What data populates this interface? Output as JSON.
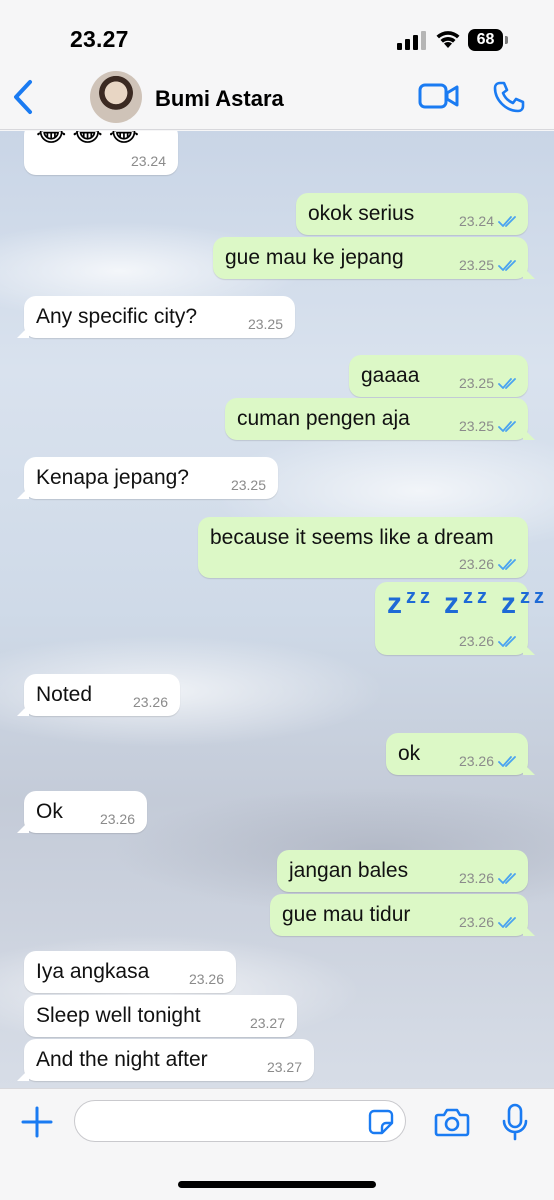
{
  "status_bar": {
    "time": "23.27",
    "battery": "68"
  },
  "header": {
    "contact_name": "Bumi Astara"
  },
  "colors": {
    "accent": "#1a7bf2",
    "incoming_bubble": "#ffffff",
    "outgoing_bubble": "#dcf8c6",
    "read_ticks": "#4aa3f0"
  },
  "messages": [
    {
      "dir": "in",
      "text": "😂😂😂",
      "time": "23.24"
    },
    {
      "dir": "out",
      "text": "okok serius",
      "time": "23.24"
    },
    {
      "dir": "out",
      "text": "gue mau ke jepang",
      "time": "23.25"
    },
    {
      "dir": "in",
      "text": "Any specific city?",
      "time": "23.25"
    },
    {
      "dir": "out",
      "text": "gaaaa",
      "time": "23.25"
    },
    {
      "dir": "out",
      "text": "cuman pengen aja",
      "time": "23.25"
    },
    {
      "dir": "in",
      "text": "Kenapa jepang?",
      "time": "23.25"
    },
    {
      "dir": "out",
      "text": "because it seems like a dream",
      "time": "23.26"
    },
    {
      "dir": "out",
      "text": "zzz zzz zzz",
      "time": "23.26"
    },
    {
      "dir": "in",
      "text": "Noted",
      "time": "23.26"
    },
    {
      "dir": "out",
      "text": "ok",
      "time": "23.26"
    },
    {
      "dir": "in",
      "text": "Ok",
      "time": "23.26"
    },
    {
      "dir": "out",
      "text": "jangan bales",
      "time": "23.26"
    },
    {
      "dir": "out",
      "text": "gue mau tidur",
      "time": "23.26"
    },
    {
      "dir": "in",
      "text": "Iya angkasa",
      "time": "23.26"
    },
    {
      "dir": "in",
      "text": "Sleep well tonight",
      "time": "23.27"
    },
    {
      "dir": "in",
      "text": "And the night after",
      "time": "23.27"
    }
  ],
  "input": {
    "placeholder": ""
  },
  "icons": {
    "back": "chevron-left-icon",
    "video": "video-camera-icon",
    "call": "phone-icon",
    "attach": "plus-icon",
    "sticker": "sticker-icon",
    "camera": "camera-icon",
    "mic": "microphone-icon"
  }
}
